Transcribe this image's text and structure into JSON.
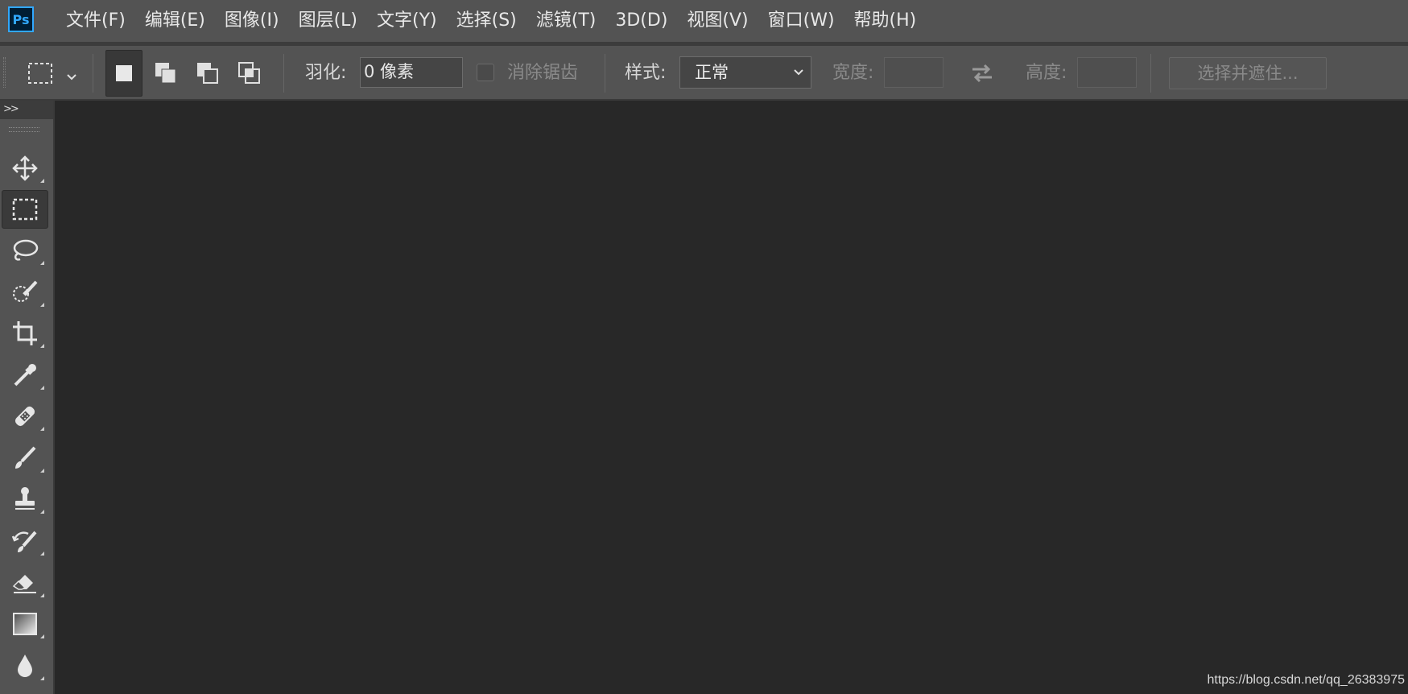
{
  "app": {
    "logo_text": "Ps",
    "brand_color": "#31a8ff"
  },
  "menu": {
    "items": [
      {
        "label": "文件(F)"
      },
      {
        "label": "编辑(E)"
      },
      {
        "label": "图像(I)"
      },
      {
        "label": "图层(L)"
      },
      {
        "label": "文字(Y)"
      },
      {
        "label": "选择(S)"
      },
      {
        "label": "滤镜(T)"
      },
      {
        "label": "3D(D)"
      },
      {
        "label": "视图(V)"
      },
      {
        "label": "窗口(W)"
      },
      {
        "label": "帮助(H)"
      }
    ]
  },
  "options": {
    "tool_preset_icon": "rect-marquee-icon",
    "selection_modes": [
      "new-selection-icon",
      "add-to-selection-icon",
      "subtract-from-selection-icon",
      "intersect-selection-icon"
    ],
    "active_mode": "new-selection-icon",
    "feather_label": "羽化:",
    "feather_value": "0 像素",
    "antialias_label": "消除锯齿",
    "antialias_checked": false,
    "style_label": "样式:",
    "style_value": "正常",
    "width_label": "宽度:",
    "width_value": "",
    "swap_icon": "swap-arrows-icon",
    "height_label": "高度:",
    "height_value": "",
    "select_mask_label": "选择并遮住..."
  },
  "toolbar": {
    "collapse_label": ">>",
    "tools": [
      {
        "icon": "move-tool-icon"
      },
      {
        "icon": "rect-marquee-tool-icon",
        "active": true
      },
      {
        "icon": "lasso-tool-icon"
      },
      {
        "icon": "quick-selection-tool-icon"
      },
      {
        "icon": "crop-tool-icon"
      },
      {
        "icon": "eyedropper-tool-icon"
      },
      {
        "icon": "healing-brush-tool-icon"
      },
      {
        "icon": "brush-tool-icon"
      },
      {
        "icon": "clone-stamp-tool-icon"
      },
      {
        "icon": "history-brush-tool-icon"
      },
      {
        "icon": "eraser-tool-icon"
      },
      {
        "icon": "gradient-tool-icon"
      },
      {
        "icon": "blur-tool-icon"
      }
    ]
  },
  "watermark": "https://blog.csdn.net/qq_26383975"
}
